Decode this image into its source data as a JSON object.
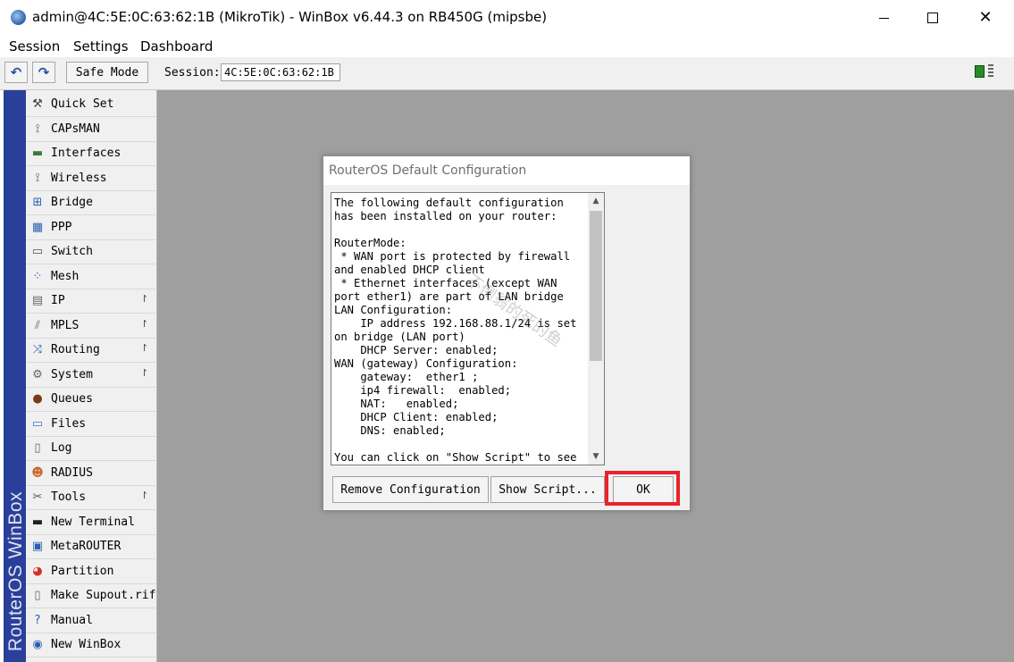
{
  "window": {
    "title": "admin@4C:5E:0C:63:62:1B (MikroTik) - WinBox v6.44.3 on RB450G (mipsbe)",
    "controls": {
      "minimize_icon": "minimize-icon",
      "maximize_icon": "maximize-icon",
      "close_glyph": "✕"
    }
  },
  "menubar": {
    "items": [
      "Session",
      "Settings",
      "Dashboard"
    ]
  },
  "toolbar": {
    "undo_glyph": "↶",
    "redo_glyph": "↷",
    "safe_mode_label": "Safe Mode",
    "session_label": "Session:",
    "session_value": "4C:5E:0C:63:62:1B"
  },
  "sidebar": {
    "brand_text": "RouterOS WinBox",
    "items": [
      {
        "label": "Quick Set",
        "icon": "quick-set-icon",
        "glyph": "⚒",
        "color": "#444444",
        "has_submenu": false
      },
      {
        "label": "CAPsMAN",
        "icon": "capsman-icon",
        "glyph": "⟟",
        "color": "#2a7a2a",
        "has_submenu": false
      },
      {
        "label": "Interfaces",
        "icon": "interfaces-icon",
        "glyph": "▬",
        "color": "#3a7a3a",
        "has_submenu": false
      },
      {
        "label": "Wireless",
        "icon": "wireless-icon",
        "glyph": "⟟",
        "color": "#2a7a2a",
        "has_submenu": false
      },
      {
        "label": "Bridge",
        "icon": "bridge-icon",
        "glyph": "⊞",
        "color": "#2a5fb0",
        "has_submenu": false
      },
      {
        "label": "PPP",
        "icon": "ppp-icon",
        "glyph": "▦",
        "color": "#2a5fb0",
        "has_submenu": false
      },
      {
        "label": "Switch",
        "icon": "switch-icon",
        "glyph": "▭",
        "color": "#555555",
        "has_submenu": false
      },
      {
        "label": "Mesh",
        "icon": "mesh-icon",
        "glyph": "⁘",
        "color": "#2a5fb0",
        "has_submenu": false
      },
      {
        "label": "IP",
        "icon": "ip-icon",
        "glyph": "▤",
        "color": "#666666",
        "has_submenu": true
      },
      {
        "label": "MPLS",
        "icon": "mpls-icon",
        "glyph": "⫽",
        "color": "#666666",
        "has_submenu": true
      },
      {
        "label": "Routing",
        "icon": "routing-icon",
        "glyph": "⤨",
        "color": "#2a5fb0",
        "has_submenu": true
      },
      {
        "label": "System",
        "icon": "system-gear-icon",
        "glyph": "⚙",
        "color": "#666666",
        "has_submenu": true
      },
      {
        "label": "Queues",
        "icon": "queues-icon",
        "glyph": "●",
        "color": "#7a3a1a",
        "has_submenu": false
      },
      {
        "label": "Files",
        "icon": "files-folder-icon",
        "glyph": "▭",
        "color": "#3a7ac8",
        "has_submenu": false
      },
      {
        "label": "Log",
        "icon": "log-icon",
        "glyph": "▯",
        "color": "#666666",
        "has_submenu": false
      },
      {
        "label": "RADIUS",
        "icon": "radius-users-icon",
        "glyph": "☻",
        "color": "#c86a2a",
        "has_submenu": false
      },
      {
        "label": "Tools",
        "icon": "tools-icon",
        "glyph": "✂",
        "color": "#555555",
        "has_submenu": true
      },
      {
        "label": "New Terminal",
        "icon": "terminal-icon",
        "glyph": "▬",
        "color": "#222222",
        "has_submenu": false
      },
      {
        "label": "MetaROUTER",
        "icon": "metarouter-icon",
        "glyph": "▣",
        "color": "#2a5fb0",
        "has_submenu": false
      },
      {
        "label": "Partition",
        "icon": "partition-pie-icon",
        "glyph": "◕",
        "color": "#d0302a",
        "has_submenu": false
      },
      {
        "label": "Make Supout.rif",
        "icon": "supout-file-icon",
        "glyph": "▯",
        "color": "#666666",
        "has_submenu": false
      },
      {
        "label": "Manual",
        "icon": "manual-help-icon",
        "glyph": "?",
        "color": "#2a5fb0",
        "has_submenu": false
      },
      {
        "label": "New WinBox",
        "icon": "new-winbox-icon",
        "glyph": "◉",
        "color": "#2a5fb0",
        "has_submenu": false
      }
    ],
    "submenu_arrow": "↾"
  },
  "dialog": {
    "title": "RouterOS Default Configuration",
    "config_text": "The following default configuration\nhas been installed on your router:\n\nRouterMode:\n * WAN port is protected by firewall\nand enabled DHCP client\n * Ethernet interfaces (except WAN\nport ether1) are part of LAN bridge\nLAN Configuration:\n    IP address 192.168.88.1/24 is set\non bridge (LAN port)\n    DHCP Server: enabled;\nWAN (gateway) Configuration:\n    gateway:  ether1 ;\n    ip4 firewall:  enabled;\n    NAT:   enabled;\n    DHCP Client: enabled;\n    DNS: enabled;\n\nYou can click on \"Show Script\" to see",
    "scroll_up_glyph": "▲",
    "scroll_down_glyph": "▼",
    "buttons": {
      "remove_configuration": "Remove Configuration",
      "show_script": "Show Script...",
      "ok": "OK"
    }
  },
  "watermark": {
    "text": "不倒翁的死的鱼"
  },
  "colors": {
    "workspace": "#9f9f9f",
    "sidebar_strip": "#2a3f9a",
    "highlight": "#e8232a",
    "status_ok": "#2a8a2a"
  }
}
